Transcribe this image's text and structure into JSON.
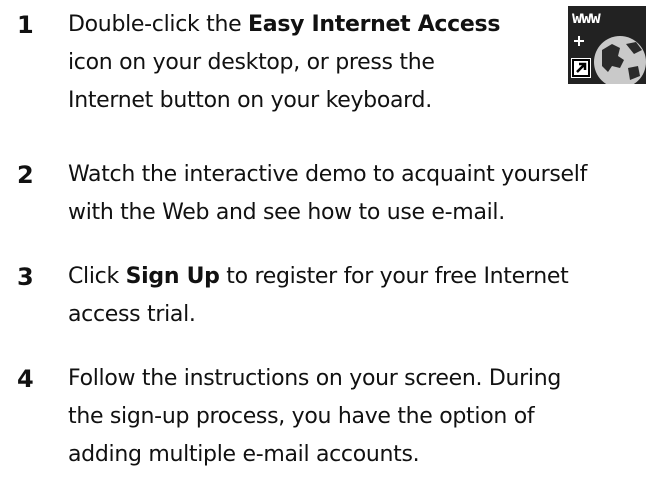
{
  "steps": [
    {
      "number": "1",
      "lines": [
        {
          "pre": "Double-click the ",
          "bold": "Easy Internet Access",
          "post": ""
        },
        {
          "pre": "icon on your desktop, or press the",
          "bold": "",
          "post": ""
        },
        {
          "pre": "Internet button on your keyboard.",
          "bold": "",
          "post": ""
        }
      ]
    },
    {
      "number": "2",
      "lines": [
        {
          "pre": "Watch the interactive demo to acquaint yourself",
          "bold": "",
          "post": ""
        },
        {
          "pre": "with the Web and see how to use e-mail.",
          "bold": "",
          "post": ""
        }
      ]
    },
    {
      "number": "3",
      "lines": [
        {
          "pre": "Click ",
          "bold": "Sign Up",
          "post": " to register for your free Internet"
        },
        {
          "pre": "access trial.",
          "bold": "",
          "post": ""
        }
      ]
    },
    {
      "number": "4",
      "lines": [
        {
          "pre": "Follow the instructions on your screen. During",
          "bold": "",
          "post": ""
        },
        {
          "pre": "the sign-up process, you have the option of",
          "bold": "",
          "post": ""
        },
        {
          "pre": "adding multiple e-mail accounts.",
          "bold": "",
          "post": ""
        }
      ]
    }
  ],
  "icon": {
    "label": "www",
    "name": "easy-internet-access-icon"
  }
}
